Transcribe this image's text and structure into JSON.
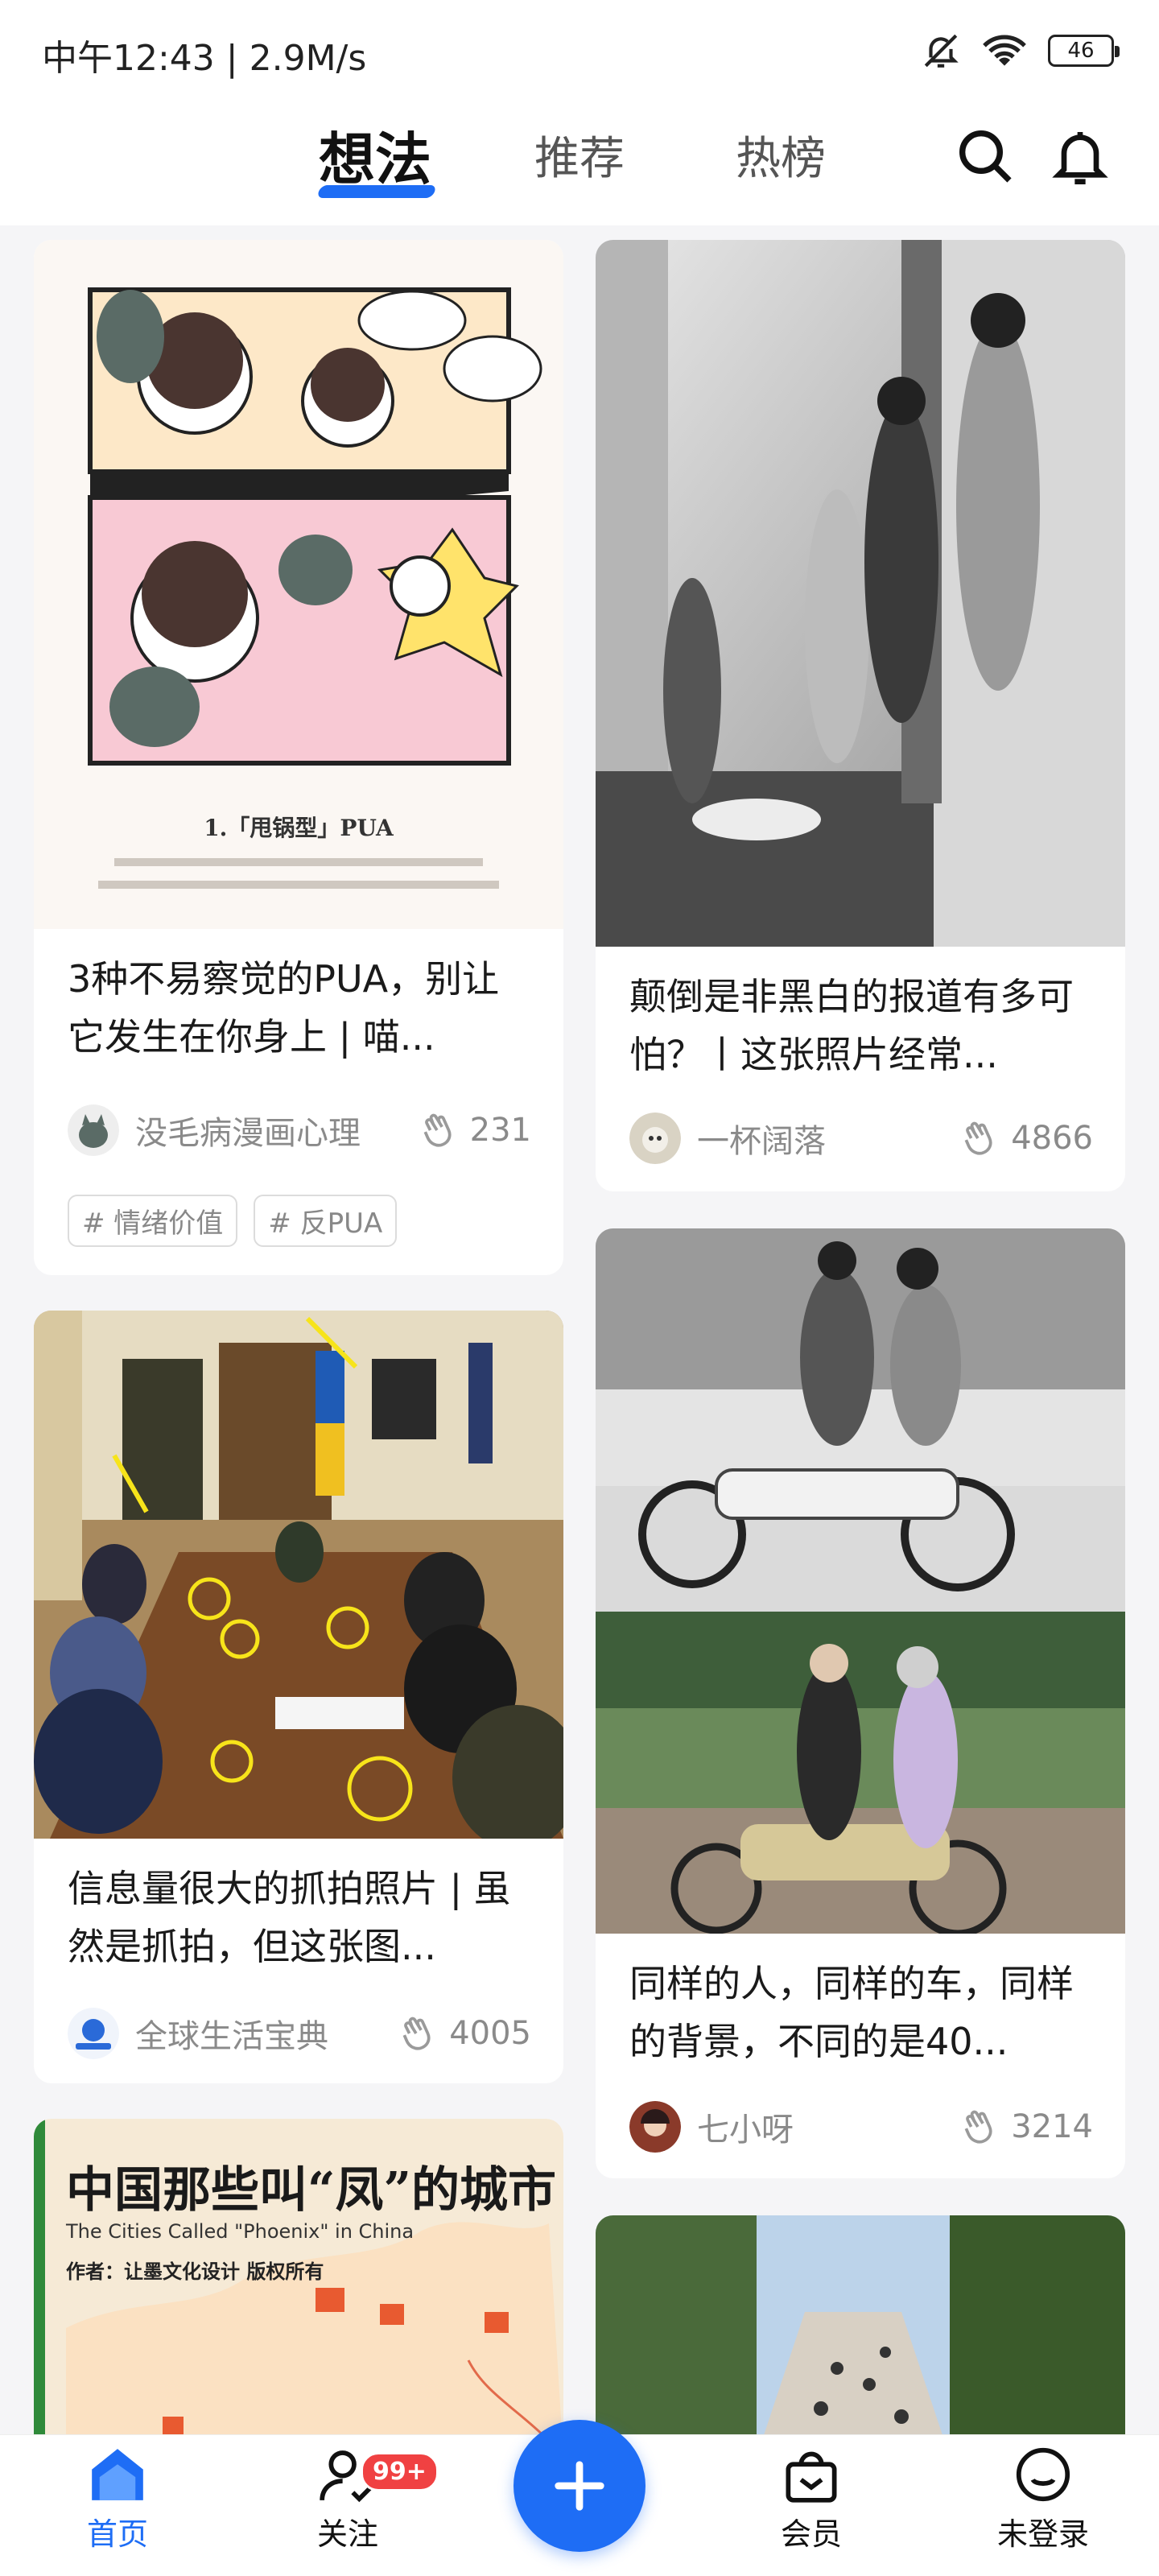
{
  "status": {
    "time_speed": "中午12:43 | 2.9M/s",
    "battery": "46"
  },
  "tabs": [
    {
      "label": "想法",
      "active": true
    },
    {
      "label": "推荐",
      "active": false
    },
    {
      "label": "热榜",
      "active": false
    }
  ],
  "feed": {
    "cards": [
      {
        "title": "3种不易察觉的PUA，别让它发生在你身上 | 喵...",
        "author": "没毛病漫画心理",
        "claps": "231",
        "tags": [
          "# 情绪价值",
          "# 反PUA"
        ]
      },
      {
        "title": "颠倒是非黑白的报道有多可怕？丨这张照片经常...",
        "author": "一杯阔落",
        "claps": "4866"
      },
      {
        "title": "信息量很大的抓拍照片 | 虽然是抓拍，但这张图...",
        "author": "全球生活宝典",
        "claps": "4005"
      },
      {
        "title": "同样的人，同样的车，同样的背景，不同的是40...",
        "author": "七小呀",
        "claps": "3214"
      },
      {
        "image_title": "中国那些叫“凤”的城市",
        "image_subtitle": "The Cities Called \"Phoenix\" in China",
        "image_credit": "作者：让墨文化设计 版权所有"
      },
      {
        "image_alt": "cats on stairs"
      }
    ]
  },
  "bottom_nav": {
    "home": "首页",
    "follow": "关注",
    "follow_badge": "99+",
    "member": "会员",
    "login": "未登录"
  },
  "colors": {
    "accent": "#1e6df5",
    "badge": "#f04142"
  }
}
